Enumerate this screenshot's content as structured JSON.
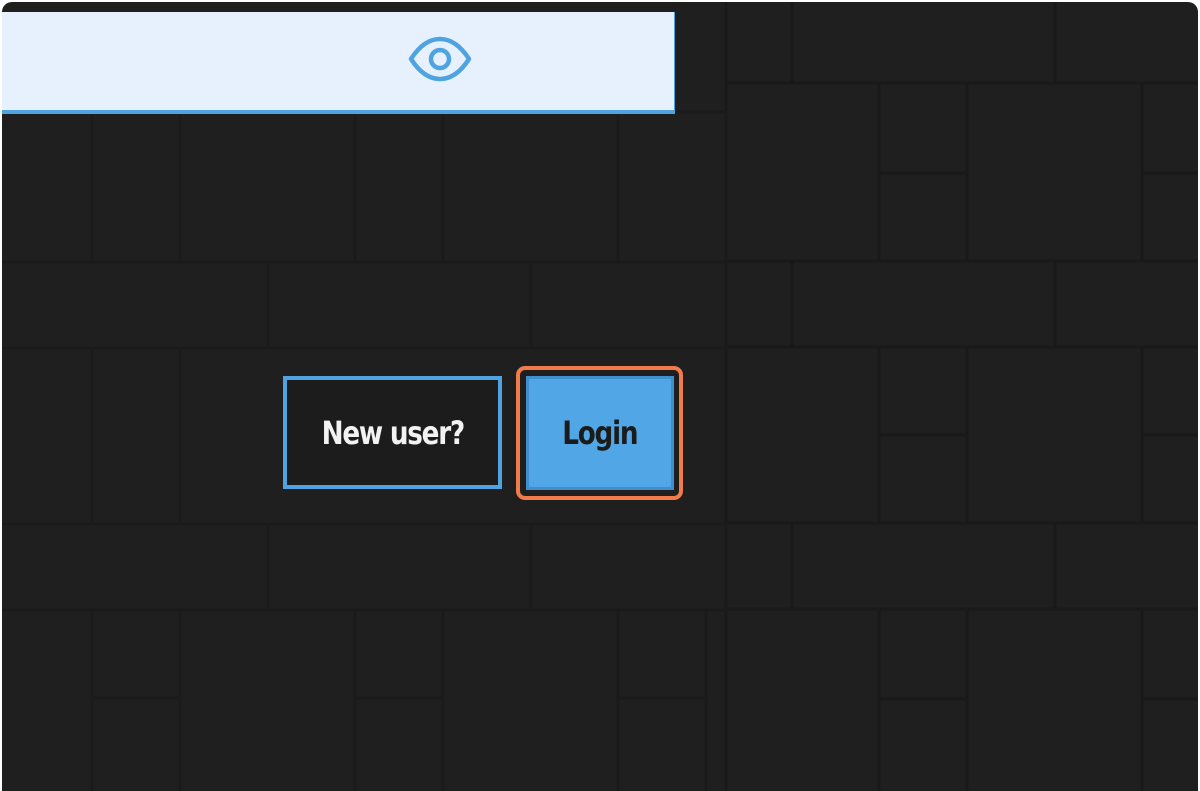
{
  "password_field": {
    "value": "",
    "toggle_icon": "eye-icon"
  },
  "actions": {
    "new_user_label": "New user?",
    "login_label": "Login"
  },
  "colors": {
    "background": "#1f1f1f",
    "field_background": "#e7f1fd",
    "accent": "#4fa3e0",
    "login_fill": "#51a7e6",
    "focus_ring": "#f27b4b"
  }
}
